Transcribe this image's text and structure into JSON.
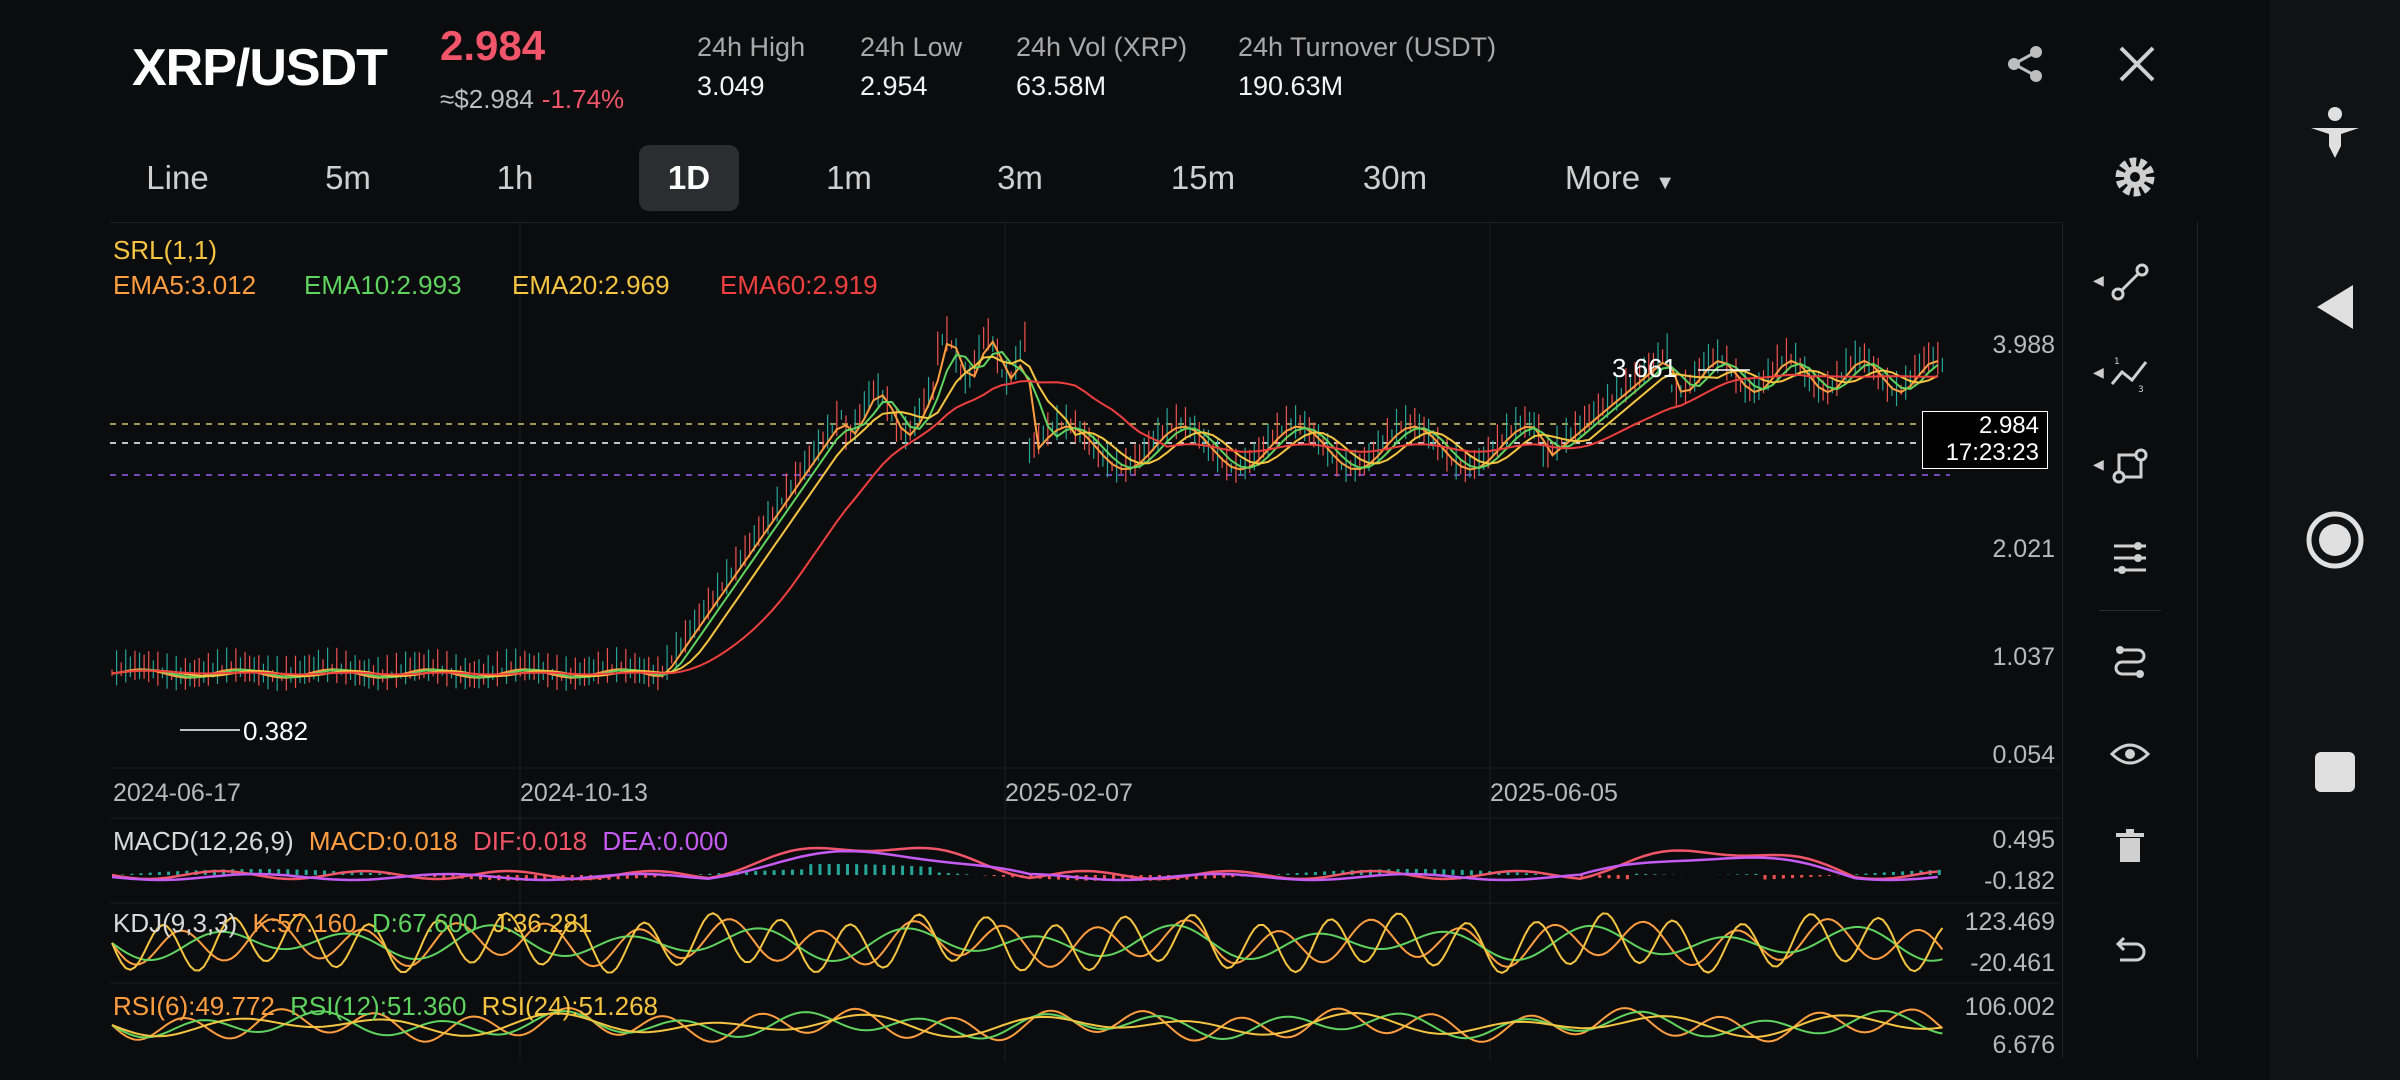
{
  "header": {
    "pair": "XRP/USDT",
    "price": "2.984",
    "usd_price": "≈$2.984",
    "change": "-1.74%",
    "stats": [
      {
        "label": "24h High",
        "value": "3.049"
      },
      {
        "label": "24h Low",
        "value": "2.954"
      },
      {
        "label": "24h Vol (XRP)",
        "value": "63.58M"
      },
      {
        "label": "24h Turnover (USDT)",
        "value": "190.63M"
      }
    ],
    "icons": [
      "share-icon",
      "close-icon"
    ]
  },
  "tabs": [
    {
      "label": "Line"
    },
    {
      "label": "5m"
    },
    {
      "label": "1h"
    },
    {
      "label": "1D"
    },
    {
      "label": "1m"
    },
    {
      "label": "3m"
    },
    {
      "label": "15m"
    },
    {
      "label": "30m"
    },
    {
      "label": "More"
    }
  ],
  "active_tab": "1D",
  "chart": {
    "srl": "SRL(1,1)",
    "ema": [
      {
        "label": "EMA5:3.012",
        "color": "#ff9e40"
      },
      {
        "label": "EMA10:2.993",
        "color": "#5fd35f"
      },
      {
        "label": "EMA20:2.969",
        "color": "#f5c542"
      },
      {
        "label": "EMA60:2.919",
        "color": "#ef4040"
      }
    ],
    "y_ticks": [
      "3.988",
      "2.021",
      "1.037",
      "0.054"
    ],
    "x_ticks": [
      "2024-06-17",
      "2024-10-13",
      "2025-02-07",
      "2025-06-05"
    ],
    "high_marker": "3.661",
    "low_marker": "0.382",
    "last_price": "2.984",
    "countdown": "17:23:23"
  },
  "macd": {
    "labels": [
      {
        "text": "MACD(12,26,9)",
        "color": "#d9d9d9"
      },
      {
        "text": "MACD:0.018",
        "color": "#ff9e40"
      },
      {
        "text": "DIF:0.018",
        "color": "#f0556a"
      },
      {
        "text": "DEA:0.000",
        "color": "#c45bf2"
      }
    ],
    "y_ticks": [
      "0.495",
      "-0.182"
    ]
  },
  "kdj": {
    "labels": [
      {
        "text": "KDJ(9,3,3)",
        "color": "#d9d9d9"
      },
      {
        "text": "K:57.160",
        "color": "#ff9e40"
      },
      {
        "text": "D:67.600",
        "color": "#5fd35f"
      },
      {
        "text": "J:36.281",
        "color": "#f5c542"
      }
    ],
    "y_ticks": [
      "123.469",
      "-20.461"
    ]
  },
  "rsi": {
    "labels": [
      {
        "text": "RSI(6):49.772",
        "color": "#ff9e40"
      },
      {
        "text": "RSI(12):51.360",
        "color": "#5fd35f"
      },
      {
        "text": "RSI(24):51.268",
        "color": "#f5c542"
      }
    ],
    "y_ticks": [
      "106.002",
      "6.676"
    ]
  },
  "tools": [
    "line-tool-icon",
    "trend-tool-icon",
    "shape-tool-icon",
    "settings-sliders-icon",
    "connect-tool-icon",
    "eye-icon",
    "trash-icon",
    "undo-icon"
  ],
  "rail": [
    "accessibility-icon",
    "back-icon",
    "home-icon",
    "recents-icon"
  ]
}
